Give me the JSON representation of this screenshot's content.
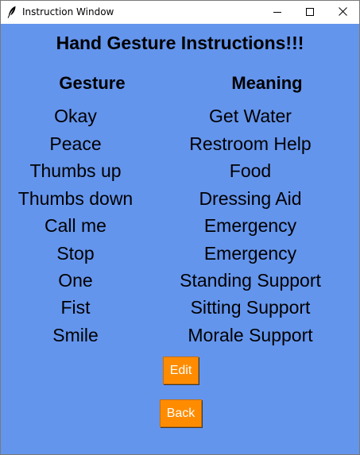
{
  "window": {
    "title": "Instruction Window",
    "app_icon": "feather-icon",
    "controls": [
      "minimize-icon",
      "maximize-icon",
      "close-icon"
    ]
  },
  "main": {
    "heading": "Hand Gesture Instructions!!!",
    "col_gesture": "Gesture",
    "col_meaning": "Meaning",
    "rows": [
      {
        "gesture": "Okay",
        "meaning": "Get Water"
      },
      {
        "gesture": "Peace",
        "meaning": "Restroom Help"
      },
      {
        "gesture": "Thumbs up",
        "meaning": "Food"
      },
      {
        "gesture": "Thumbs down",
        "meaning": "Dressing Aid"
      },
      {
        "gesture": "Call me",
        "meaning": "Emergency"
      },
      {
        "gesture": "Stop",
        "meaning": "Emergency"
      },
      {
        "gesture": "One",
        "meaning": "Standing Support"
      },
      {
        "gesture": "Fist",
        "meaning": "Sitting Support"
      },
      {
        "gesture": "Smile",
        "meaning": "Morale Support"
      }
    ],
    "edit_label": "Edit",
    "back_label": "Back"
  },
  "colors": {
    "background": "#6495ed",
    "button": "#ff8c00",
    "button_text": "#ffffff"
  }
}
